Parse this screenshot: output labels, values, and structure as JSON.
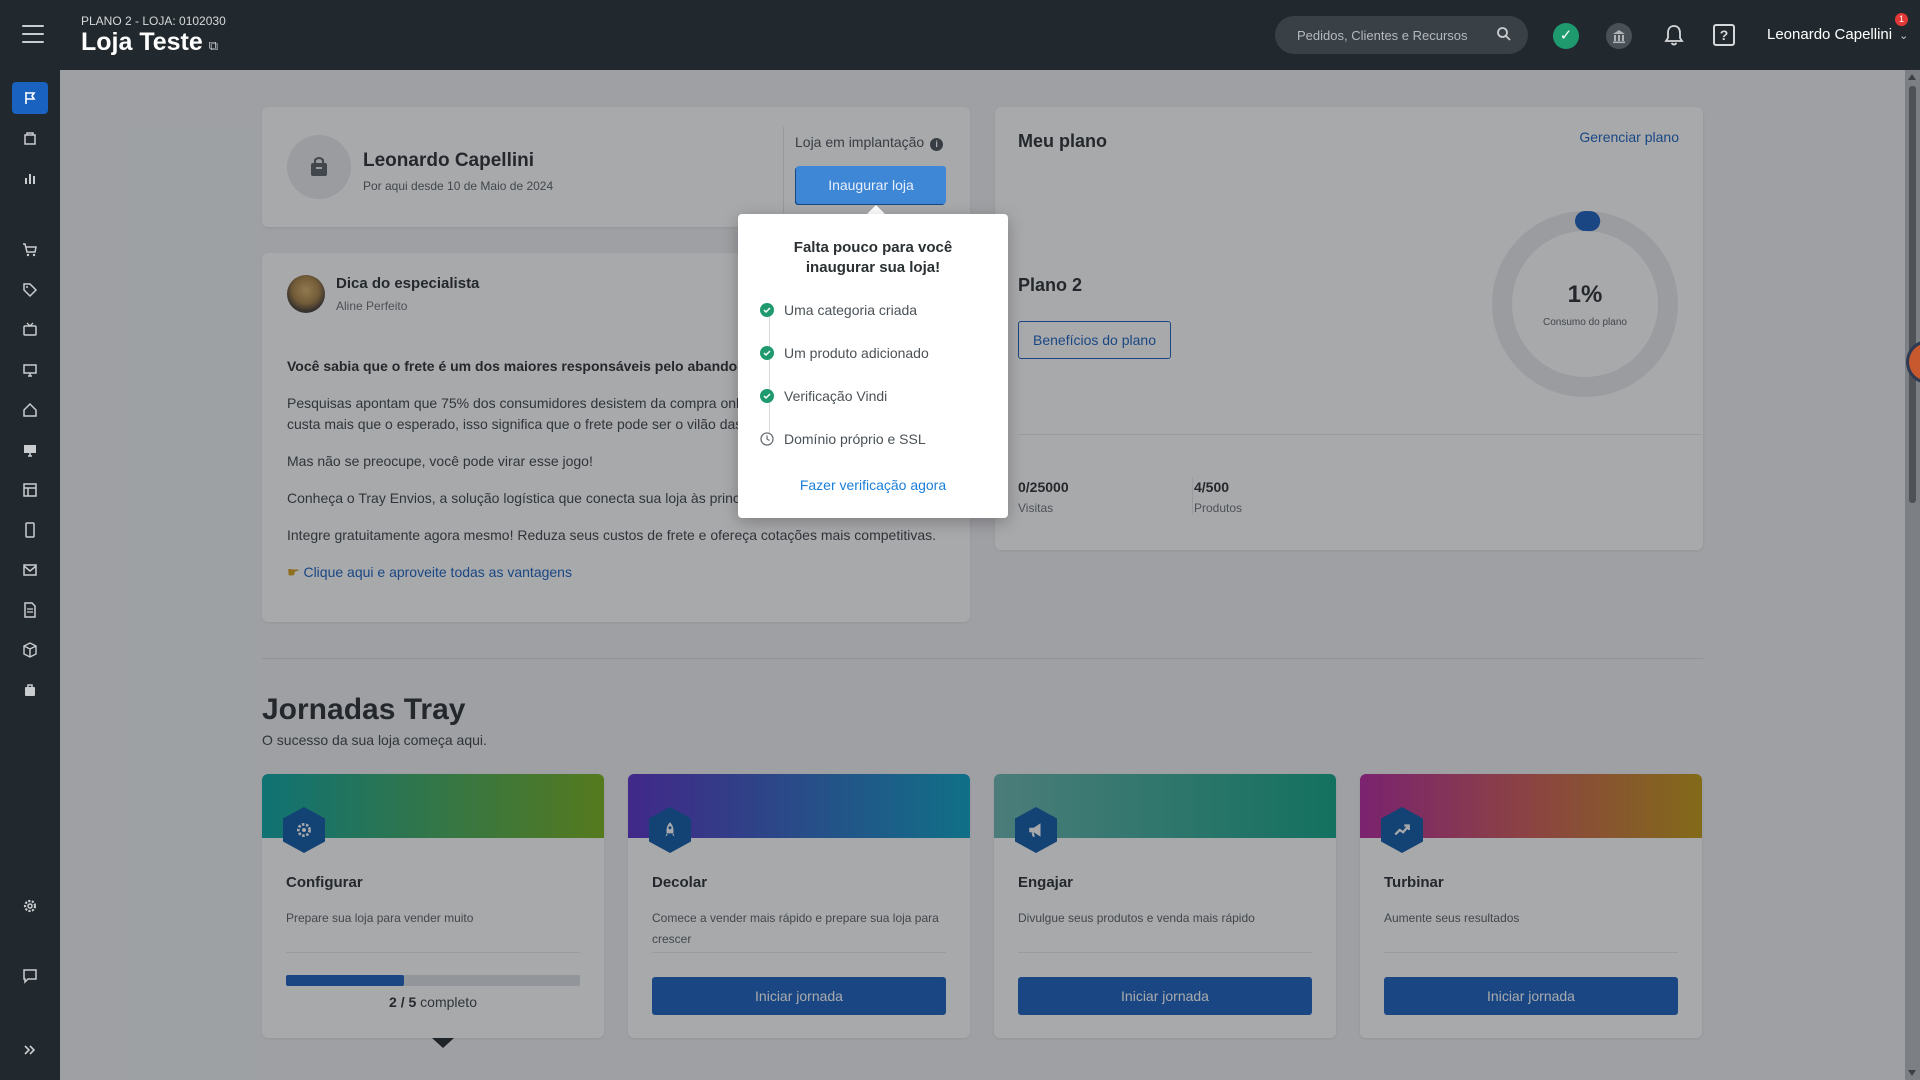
{
  "header": {
    "plan_store": "PLANO 2 - LOJA: 0102030",
    "store_name": "Loja Teste",
    "search_placeholder": "Pedidos, Clientes e Recursos",
    "user_name": "Leonardo Capellini",
    "notification_count": "1"
  },
  "profile": {
    "owner_name": "Leonardo Capellini",
    "since": "Por aqui desde 10 de Maio de 2024",
    "status": "Loja em implantação",
    "inaugurate_label": "Inaugurar loja"
  },
  "tip": {
    "title": "Dica do especialista",
    "author": "Aline Perfeito",
    "headline": "Você sabia que o frete é um dos maiores responsáveis pelo abandono",
    "p1": "Pesquisas apontam que 75% dos consumidores desistem da compra onl",
    "p1b": "custa mais que o esperado, isso significa que o frete pode ser o vilão das",
    "p2": "Mas não se preocupe, você pode virar esse jogo!",
    "p3": "Conheça o Tray Envios, a solução logística que conecta sua loja às princip",
    "p4": "Integre gratuitamente agora mesmo! Reduza seus custos de frete e ofereça cotações mais competitivas.",
    "link": "Clique aqui e aproveite todas as vantagens"
  },
  "plan": {
    "title": "Meu plano",
    "manage_label": "Gerenciar plano",
    "plan_name": "Plano 2",
    "benefits_label": "Benefícios do plano",
    "usage_pct": "1%",
    "usage_value": 0.01,
    "usage_label": "Consumo do plano",
    "visits_value": "0/25000",
    "visits_label": "Visitas",
    "products_value": "4/500",
    "products_label": "Produtos"
  },
  "journeys": {
    "title": "Jornadas Tray",
    "subtitle": "O sucesso da sua loja começa aqui.",
    "cards": [
      {
        "name": "Configurar",
        "desc": "Prepare sua loja para vender muito",
        "progress_done": "2",
        "progress_total": "5",
        "progress_suffix": "completo",
        "progress_fraction": 0.4,
        "icon": "gear-icon"
      },
      {
        "name": "Decolar",
        "desc": "Comece a vender mais rápido e prepare sua loja para crescer",
        "button": "Iniciar jornada",
        "icon": "rocket-icon"
      },
      {
        "name": "Engajar",
        "desc": "Divulgue seus produtos e venda mais rápido",
        "button": "Iniciar jornada",
        "icon": "megaphone-icon"
      },
      {
        "name": "Turbinar",
        "desc": "Aumente seus resultados",
        "button": "Iniciar jornada",
        "icon": "trending-up-icon"
      }
    ]
  },
  "popover": {
    "title": "Falta pouco para você inaugurar sua loja!",
    "steps": [
      {
        "label": "Uma categoria criada",
        "done": true
      },
      {
        "label": "Um produto adicionado",
        "done": true
      },
      {
        "label": "Verificação Vindi",
        "done": true
      },
      {
        "label": "Domínio próprio e SSL",
        "done": false
      }
    ],
    "cta": "Fazer verificação agora"
  },
  "colors": {
    "primary": "#1a62c0",
    "topbar": "#22292e",
    "success": "#1f9a6f",
    "link": "#1a7fd8"
  }
}
